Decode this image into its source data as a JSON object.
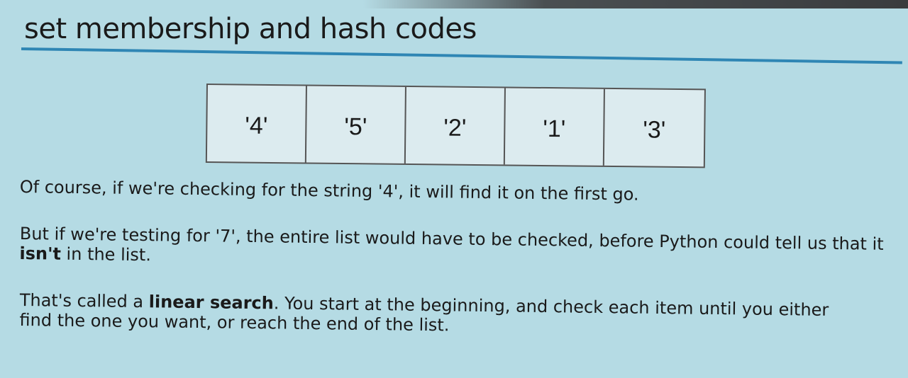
{
  "title": "set membership and hash codes",
  "list_items": [
    "'4'",
    "'5'",
    "'2'",
    "'1'",
    "'3'"
  ],
  "paragraphs": {
    "p1": "Of course, if we're checking for the string '4', it will find it on the first go.",
    "p2_a": "But if we're testing for '7', the entire list would have to be checked, before Python could tell us that it ",
    "p2_bold": "isn't",
    "p2_b": " in the list.",
    "p3_a": "That's called a ",
    "p3_bold": "linear search",
    "p3_b": ". You start at the beginning, and check each item until you either find the one you want, or reach the end of the list."
  }
}
